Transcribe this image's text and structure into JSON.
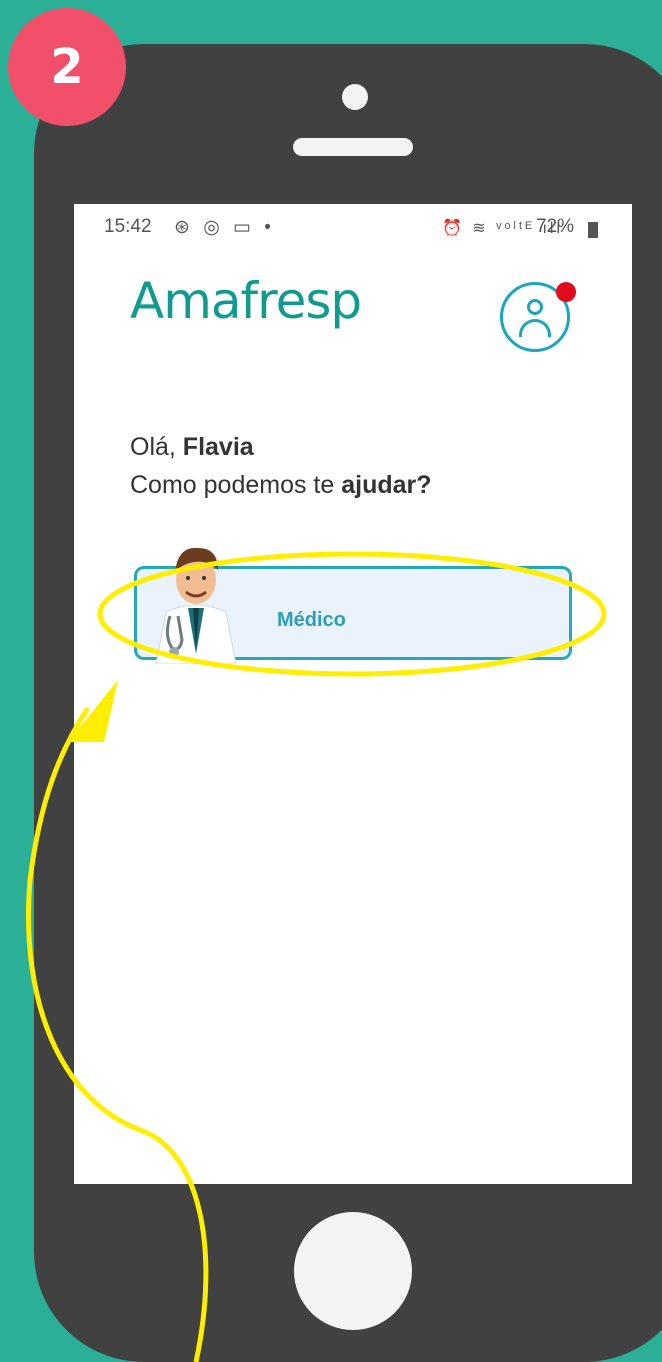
{
  "colors": {
    "background": "#2bb097",
    "badge": "#f24f6b",
    "phone": "#414141",
    "brand": "#119b8f",
    "accent": "#27a7bb",
    "annotation": "#ffee00",
    "notification": "#e20b1d"
  },
  "step_badge": "2",
  "status_bar": {
    "time": "15:42",
    "left_icons": "⊛ ◎ ▭ •",
    "right_icons": "⏰ ≋ ᵛᵒˡᵗᴱ ıll",
    "battery": "72%"
  },
  "app": {
    "logo": "Amafresp",
    "greeting_prefix": "Olá, ",
    "user_name": "Flavia",
    "question_prefix": "Como podemos te ",
    "question_bold": "ajudar?",
    "card_label": "Médico"
  },
  "icons": [
    "profile-icon",
    "notification-dot",
    "doctor-illustration",
    "annotation-arrow",
    "annotation-ellipse"
  ]
}
